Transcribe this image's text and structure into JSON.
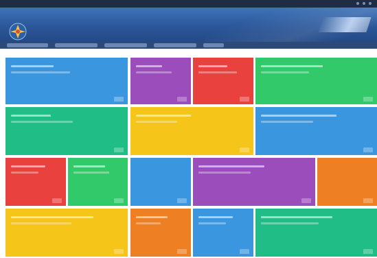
{
  "window": {
    "title": ""
  },
  "header": {
    "title": "",
    "subtitle": ""
  },
  "nav": {
    "items": [
      "",
      "",
      "",
      "",
      ""
    ]
  },
  "colors": {
    "blue": "#3a97df",
    "purple": "#9b4dbc",
    "red": "#e8413e",
    "green": "#31c96a",
    "teal": "#20bd86",
    "yellow": "#f5c51a",
    "orange": "#ee7f22"
  },
  "tiles": [
    {
      "id": "t1",
      "color": "blue",
      "title": "",
      "subtitle": "",
      "count": ""
    },
    {
      "id": "t2",
      "color": "purple",
      "title": "",
      "subtitle": "",
      "count": ""
    },
    {
      "id": "t3",
      "color": "red",
      "title": "",
      "subtitle": "",
      "count": ""
    },
    {
      "id": "t4",
      "color": "green",
      "title": "",
      "subtitle": "",
      "count": ""
    },
    {
      "id": "t5",
      "color": "teal",
      "title": "",
      "subtitle": "",
      "count": ""
    },
    {
      "id": "t6",
      "color": "yellow",
      "title": "",
      "subtitle": "",
      "count": ""
    },
    {
      "id": "t7",
      "color": "blue",
      "title": "",
      "subtitle": "",
      "count": ""
    },
    {
      "id": "t8",
      "color": "red",
      "title": "",
      "subtitle": "",
      "count": ""
    },
    {
      "id": "t9",
      "color": "green",
      "title": "",
      "subtitle": "",
      "count": ""
    },
    {
      "id": "t10",
      "color": "blue",
      "title": "",
      "subtitle": "",
      "count": ""
    },
    {
      "id": "t11",
      "color": "purple",
      "title": "",
      "subtitle": "",
      "count": ""
    },
    {
      "id": "t12",
      "color": "orange",
      "title": "",
      "subtitle": "",
      "count": ""
    },
    {
      "id": "t13",
      "color": "yellow",
      "title": "",
      "subtitle": "",
      "count": ""
    },
    {
      "id": "t14",
      "color": "orange",
      "title": "",
      "subtitle": "",
      "count": ""
    },
    {
      "id": "t15",
      "color": "blue",
      "title": "",
      "subtitle": "",
      "count": ""
    },
    {
      "id": "t16",
      "color": "teal",
      "title": "",
      "subtitle": "",
      "count": ""
    }
  ]
}
